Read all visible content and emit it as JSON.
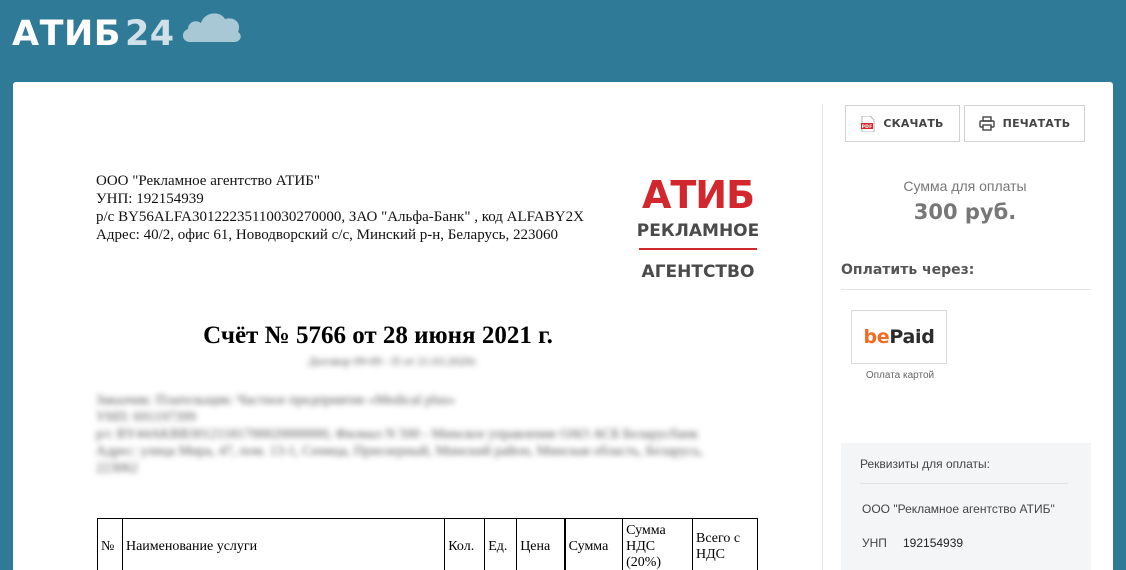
{
  "header": {
    "logo_text": "АТИБ",
    "logo_number": "24",
    "cloud_icon": "cloud-icon"
  },
  "document": {
    "company": {
      "line1": "ООО \"Рекламное агентство АТИБ\"",
      "line2": "УНП: 192154939",
      "line3": "р/с BY56ALFA30122235110030270000, ЗАО \"Альфа-Банк\" , код ALFABY2X",
      "line4": "Адрес: 40/2, офис 61, Новодворский с/с, Минский р-н, Беларусь, 223060"
    },
    "brand_logo": {
      "line1": "АТИБ",
      "line2": "РЕКЛАМНОЕ",
      "line3": "АГЕНТСТВО"
    },
    "invoice_title": "Счёт № 5766 от 28 июня 2021 г.",
    "contract_line": "Договор 09-09 - П от 21.03.2020г.",
    "client": {
      "line1": "Заказчик: Плательщик: Частное предприятие «Medical plus»",
      "line2": "УНП: 691197399",
      "line3": "р/с BY44AKBB30121181700020000000, Филиал N 500 - Минское управление ОАО АСБ Беларусбанк",
      "line4": "Адрес: улица Мира, 47, пом. 13-1, Сеница, Приозерный, Минский район, Минская область, Беларусь, 223062"
    },
    "table_headers": [
      "№",
      "Наименование услуги",
      "Кол.",
      "Ед.",
      "Цена",
      "Сумма",
      "Сумма НДС (20%)",
      "Всего с НДС"
    ]
  },
  "sidebar": {
    "download_label": "СКАЧАТЬ",
    "print_label": "ПЕЧАТАТЬ",
    "sum_label": "Сумма для оплаты",
    "sum_value": "300 руб.",
    "pay_via_label": "Оплатить через:",
    "bepaid_be": "be",
    "bepaid_paid": "Paid",
    "bepaid_caption": "Оплата картой",
    "requisites": {
      "title": "Реквизиты для оплаты:",
      "company": "ООО \"Рекламное агентство АТИБ\"",
      "unp_label": "УНП",
      "unp_value": "192154939"
    }
  },
  "colors": {
    "header_bg": "#2f7a96",
    "brand_red": "#d3272e",
    "brand_gray": "#4a4a4a",
    "bepaid_orange": "#f36b21"
  }
}
